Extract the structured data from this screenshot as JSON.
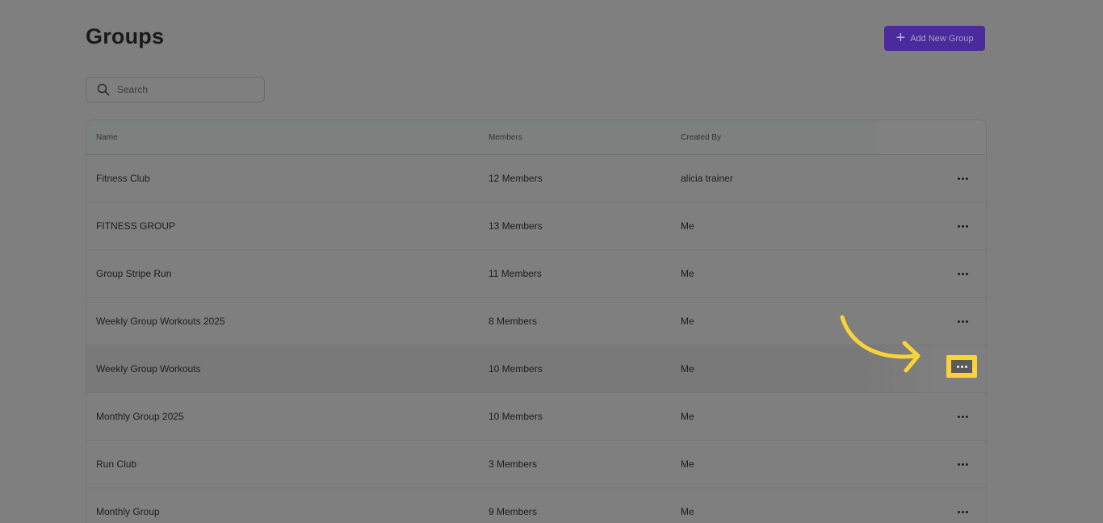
{
  "page": {
    "title": "Groups",
    "add_button_label": "Add New Group",
    "add_icon": "plus-icon"
  },
  "search": {
    "placeholder": "Search",
    "value": "",
    "icon": "search-icon"
  },
  "table": {
    "columns": {
      "name": "Name",
      "members": "Members",
      "created_by": "Created By"
    },
    "rows": [
      {
        "name": "Fitness Club",
        "members": "12 Members",
        "created_by": "alicia trainer"
      },
      {
        "name": "FITNESS GROUP",
        "members": "13 Members",
        "created_by": "Me"
      },
      {
        "name": "Group Stripe Run",
        "members": "11 Members",
        "created_by": "Me"
      },
      {
        "name": "Weekly Group Workouts 2025",
        "members": "8 Members",
        "created_by": "Me"
      },
      {
        "name": "Weekly Group Workouts",
        "members": "10 Members",
        "created_by": "Me"
      },
      {
        "name": "Monthly Group 2025",
        "members": "10 Members",
        "created_by": "Me"
      },
      {
        "name": "Run Club",
        "members": "3 Members",
        "created_by": "Me"
      },
      {
        "name": "Monthly Group",
        "members": "9 Members",
        "created_by": "Me"
      }
    ],
    "row_action_icon": "more-horizontal-icon",
    "highlighted_row_index": 4
  },
  "colors": {
    "overlay_background": "#7f7f7f",
    "primary_button": "#4a2a9c",
    "highlight_box": "#f8d43a",
    "annotation_arrow": "#f8d43a"
  }
}
